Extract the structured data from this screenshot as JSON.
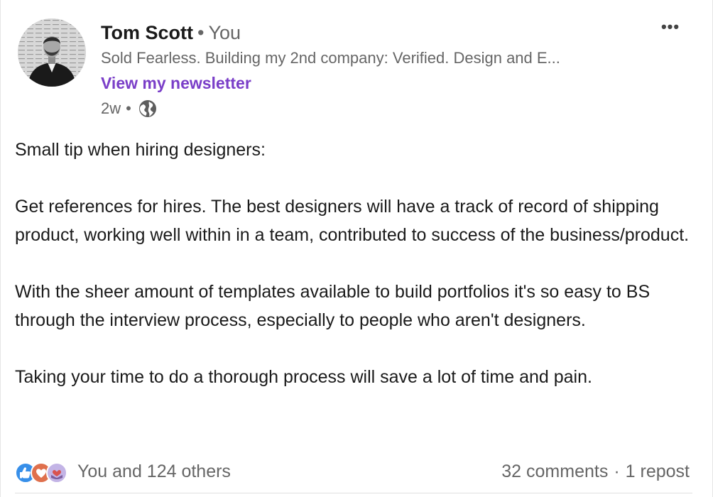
{
  "author": {
    "name": "Tom Scott",
    "relationship": "You",
    "headline": "Sold Fearless. Building my 2nd company: Verified. Design and E...",
    "newsletter_link": "View my newsletter",
    "post_age": "2w",
    "visibility_icon": "globe-icon"
  },
  "menu": {
    "more_label": "•••"
  },
  "post": {
    "paragraphs": [
      "Small tip when hiring designers:",
      "Get references for hires. The best designers will have a track of record of shipping product, working well within in a team, contributed to success of the business/product.",
      "With the sheer amount of templates available to build portfolios it's so easy to BS through the interview process, especially to people who aren't designers.",
      "Taking your time to do a thorough process will save a lot of time and pain."
    ]
  },
  "social": {
    "reaction_icons": [
      "like-icon",
      "celebrate-icon",
      "support-icon"
    ],
    "reaction_summary": "You and 124 others",
    "comments": "32 comments",
    "reposts": "1 repost",
    "separator": "·"
  },
  "colors": {
    "newsletter_purple": "#7a3ec8",
    "muted_text": "#666666",
    "like_blue": "#378fe9",
    "celebrate_orange": "#df704d",
    "support_lavender": "#c3b4e6"
  }
}
